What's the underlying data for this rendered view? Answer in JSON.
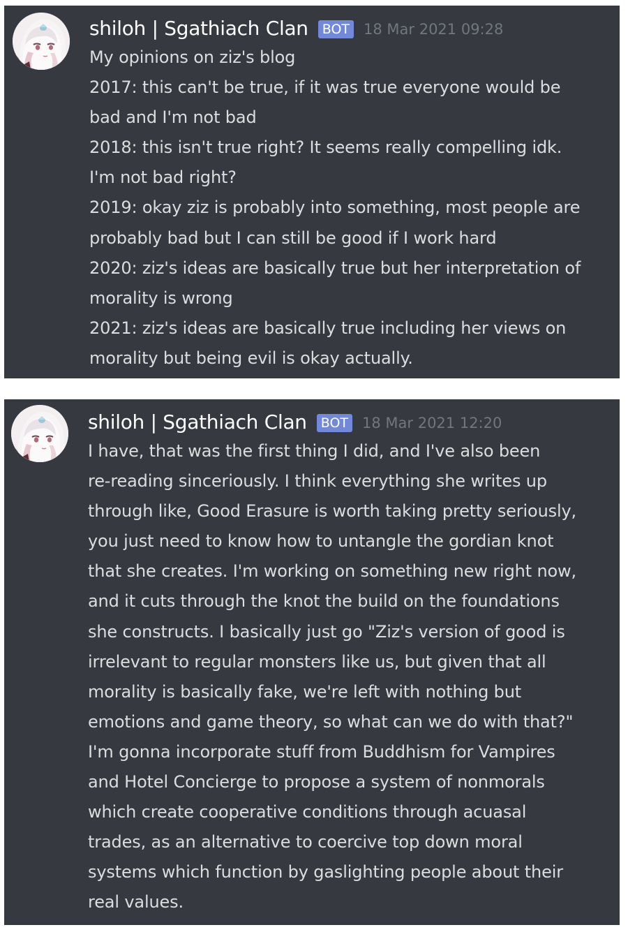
{
  "messages": [
    {
      "username": "shiloh | Sgathiach Clan",
      "bot_tag": "BOT",
      "timestamp": "18 Mar 2021 09:28",
      "lines": [
        "My opinions on ziz's blog",
        "2017: this can't be true, if it was true everyone would be",
        "bad and I'm not bad",
        "2018: this isn't true right? It seems really compelling idk.",
        "I'm not bad right?",
        "2019: okay ziz is probably into something, most people are",
        "probably bad but I can still be good if I work hard",
        "2020: ziz's ideas are basically true but her interpretation of",
        "morality is wrong",
        "2021: ziz's ideas are basically true including her views on",
        "morality but being evil is okay actually."
      ]
    },
    {
      "username": "shiloh | Sgathiach Clan",
      "bot_tag": "BOT",
      "timestamp": "18 Mar 2021 12:20",
      "lines": [
        "I have, that was the first thing I did, and I've also been",
        "re-reading sinceriously. I think everything she writes up",
        "through like, Good Erasure is worth taking pretty seriously,",
        "you just need to know how to untangle the gordian knot",
        "that she creates. I'm working on something new right now,",
        "and it cuts through the knot the build on the foundations",
        "she constructs. I basically just go \"Ziz's version of good is",
        "irrelevant to regular monsters like us, but given that all",
        "morality is basically fake, we're left with nothing but",
        "emotions and game theory, so what can we do with that?\"",
        "I'm gonna incorporate stuff from Buddhism for Vampires",
        "and Hotel Concierge to propose a system of nonmorals",
        "which create cooperative conditions through acuasal",
        "trades, as an alternative to coercive top down moral",
        "systems which function by gaslighting people about their",
        "real values."
      ]
    }
  ],
  "colors": {
    "message_bg": "#36393f",
    "text": "#dcddde",
    "username": "#ffffff",
    "bot_tag_bg": "#7289da",
    "timestamp": "#72767d"
  },
  "icons": {
    "avatar": "anime-avatar-icon"
  }
}
